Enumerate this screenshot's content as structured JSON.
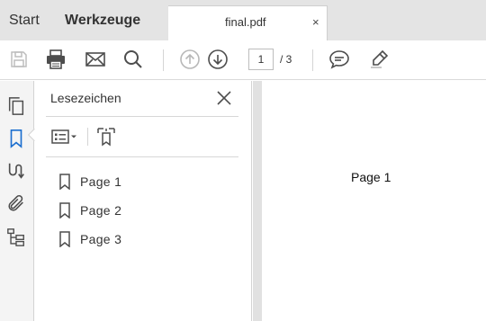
{
  "tabs": {
    "home": "Start",
    "tools": "Werkzeuge",
    "document": "final.pdf",
    "close": "×"
  },
  "toolbar": {
    "icons": [
      "save-icon",
      "print-icon",
      "email-icon",
      "search-icon",
      "previous-page-icon",
      "next-page-icon",
      "comment-icon",
      "highlight-pen-icon"
    ],
    "page_current": "1",
    "page_total": "/ 3"
  },
  "rail": {
    "icons": [
      "page-thumbnails-icon",
      "bookmark-icon",
      "signatures-icon",
      "attachments-icon",
      "content-tree-icon"
    ],
    "active": "bookmark-icon"
  },
  "bookmarks_panel": {
    "title": "Lesezeichen",
    "items": [
      {
        "label": "Page 1"
      },
      {
        "label": "Page 2"
      },
      {
        "label": "Page 3"
      }
    ]
  },
  "document": {
    "page_text": "Page 1"
  },
  "colors": {
    "tabbar_bg": "#e4e4e4",
    "rail_bg": "#f4f4f4",
    "accent_blue": "#1c6fcf",
    "icon_gray": "#4d4d4d",
    "gutter": "#e1e1e1"
  }
}
